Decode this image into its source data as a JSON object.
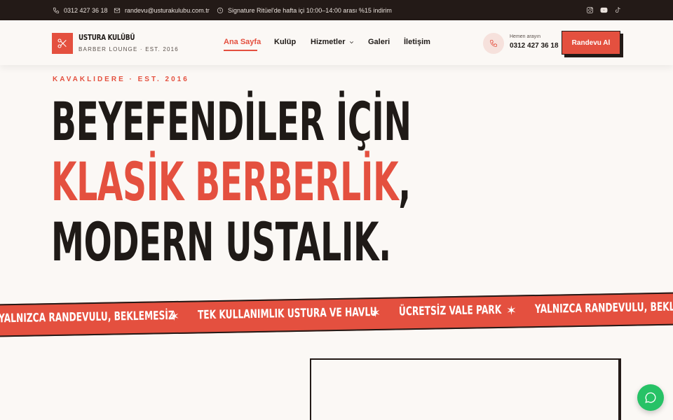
{
  "topbar": {
    "phone": "0312 427 36 18",
    "email": "randevu@usturakulubu.com.tr",
    "promo": "Signature Ritüel'de hafta içi 10:00–14:00 arası %15 indirim",
    "social": [
      "instagram-icon",
      "youtube-icon",
      "tiktok-icon"
    ]
  },
  "brand": {
    "name": "USTURA KULÜBÜ",
    "subtitle": "BARBER LOUNGE · EST. 2016"
  },
  "nav": {
    "items": [
      {
        "label": "Ana Sayfa",
        "active": true
      },
      {
        "label": "Kulüp"
      },
      {
        "label": "Hizmetler",
        "dropdown": true
      },
      {
        "label": "Galeri"
      },
      {
        "label": "İletişim"
      }
    ]
  },
  "contact": {
    "label": "Hemen arayın",
    "number": "0312 427 36 18"
  },
  "cta": {
    "label": "Randevu Al"
  },
  "hero": {
    "eyebrow": "KAVAKLIDERE · EST. 2016",
    "line1": "BEYEFENDİLER İÇİN",
    "line2": "KLASİK BERBERLİK",
    "line2_comma": ",",
    "line3": "MODERN USTALIK."
  },
  "marquee": {
    "items": [
      "YALNIZCA RANDEVULU, BEKLEMESİZ",
      "TEK KULLANIMLIK USTURA VE HAVLU",
      "ÜCRETSİZ VALE PARK",
      "YALNIZCA RANDEVULU, BEKLEMESİZ"
    ],
    "separator": "✶"
  },
  "colors": {
    "accent": "#e4503f",
    "dark": "#231a17",
    "background": "#fbf8f5",
    "chat": "#27c266"
  }
}
